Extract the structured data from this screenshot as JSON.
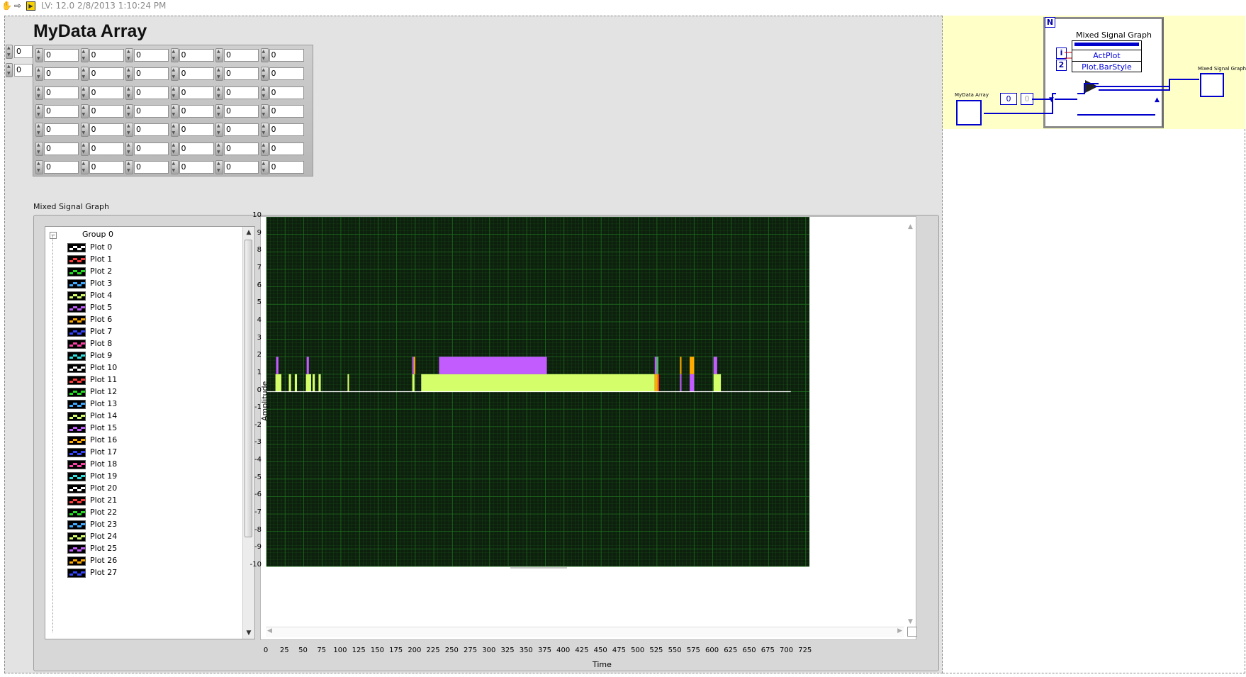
{
  "topbar": {
    "version_text": "LV: 12.0 2/8/2013 1:10:24 PM",
    "icons": [
      "hand-tool-icon",
      "run-arrow-icon",
      "vi-icon"
    ]
  },
  "front_panel": {
    "array_title": "MyData Array",
    "index_values": [
      "0",
      "0"
    ],
    "array_values": [
      [
        "0",
        "0",
        "0",
        "0",
        "0",
        "0"
      ],
      [
        "0",
        "0",
        "0",
        "0",
        "0",
        "0"
      ],
      [
        "0",
        "0",
        "0",
        "0",
        "0",
        "0"
      ],
      [
        "0",
        "0",
        "0",
        "0",
        "0",
        "0"
      ],
      [
        "0",
        "0",
        "0",
        "0",
        "0",
        "0"
      ],
      [
        "0",
        "0",
        "0",
        "0",
        "0",
        "0"
      ],
      [
        "0",
        "0",
        "0",
        "0",
        "0",
        "0"
      ]
    ],
    "graph_label": "Mixed Signal Graph"
  },
  "legend": {
    "group": "Group 0",
    "plots": [
      {
        "label": "Plot 0",
        "color": "#ffffff"
      },
      {
        "label": "Plot 1",
        "color": "#ff3b3b"
      },
      {
        "label": "Plot 2",
        "color": "#22dd22"
      },
      {
        "label": "Plot 3",
        "color": "#3fa9ff"
      },
      {
        "label": "Plot 4",
        "color": "#d4ff6a"
      },
      {
        "label": "Plot 5",
        "color": "#c25cff"
      },
      {
        "label": "Plot 6",
        "color": "#ffaa00"
      },
      {
        "label": "Plot 7",
        "color": "#3344ff"
      },
      {
        "label": "Plot 8",
        "color": "#ff3fa8"
      },
      {
        "label": "Plot 9",
        "color": "#33e0e0"
      },
      {
        "label": "Plot 10",
        "color": "#ffffff"
      },
      {
        "label": "Plot 11",
        "color": "#ff3b3b"
      },
      {
        "label": "Plot 12",
        "color": "#22dd22"
      },
      {
        "label": "Plot 13",
        "color": "#3fa9ff"
      },
      {
        "label": "Plot 14",
        "color": "#d4ff6a"
      },
      {
        "label": "Plot 15",
        "color": "#c25cff"
      },
      {
        "label": "Plot 16",
        "color": "#ffaa00"
      },
      {
        "label": "Plot 17",
        "color": "#3344ff"
      },
      {
        "label": "Plot 18",
        "color": "#ff3fa8"
      },
      {
        "label": "Plot 19",
        "color": "#33e0e0"
      },
      {
        "label": "Plot 20",
        "color": "#ffffff"
      },
      {
        "label": "Plot 21",
        "color": "#ff3b3b"
      },
      {
        "label": "Plot 22",
        "color": "#22dd22"
      },
      {
        "label": "Plot 23",
        "color": "#3fa9ff"
      },
      {
        "label": "Plot 24",
        "color": "#d4ff6a"
      },
      {
        "label": "Plot 25",
        "color": "#c25cff"
      },
      {
        "label": "Plot 26",
        "color": "#ffaa00"
      },
      {
        "label": "Plot 27",
        "color": "#3344ff"
      }
    ]
  },
  "chart_data": {
    "type": "bar",
    "xlabel": "Time",
    "ylabel": "Amplitude",
    "xlim": [
      0,
      730
    ],
    "ylim": [
      -10,
      10
    ],
    "x_ticks": [
      0,
      25,
      50,
      75,
      100,
      125,
      150,
      175,
      200,
      225,
      250,
      275,
      300,
      325,
      350,
      375,
      400,
      425,
      450,
      475,
      500,
      525,
      550,
      575,
      600,
      625,
      650,
      675,
      700,
      725
    ],
    "y_ticks": [
      10,
      9,
      8,
      7,
      6,
      5,
      4,
      3,
      2,
      1,
      0,
      -1,
      -2,
      -3,
      -4,
      -5,
      -6,
      -7,
      -8,
      -9,
      -10
    ],
    "baseline": {
      "x": [
        0,
        705
      ],
      "y": 0,
      "color": "#ffffff"
    },
    "background": "#0d1f0d",
    "grid_color": "#1f6e1f",
    "bars": [
      {
        "x0": 12,
        "x1": 20,
        "y0": 0,
        "y1": 1,
        "color": "#d4ff6a"
      },
      {
        "x0": 13,
        "x1": 16,
        "y0": 1,
        "y1": 2,
        "color": "#c25cff"
      },
      {
        "x0": 30,
        "x1": 33,
        "y0": 0,
        "y1": 1,
        "color": "#d4ff6a"
      },
      {
        "x0": 38,
        "x1": 41,
        "y0": 0,
        "y1": 1,
        "color": "#d4ff6a"
      },
      {
        "x0": 53,
        "x1": 60,
        "y0": 0,
        "y1": 1,
        "color": "#d4ff6a"
      },
      {
        "x0": 54,
        "x1": 57,
        "y0": 1,
        "y1": 2,
        "color": "#c25cff"
      },
      {
        "x0": 62,
        "x1": 65,
        "y0": 0,
        "y1": 1,
        "color": "#d4ff6a"
      },
      {
        "x0": 70,
        "x1": 73,
        "y0": 0,
        "y1": 1,
        "color": "#d4ff6a"
      },
      {
        "x0": 109,
        "x1": 111,
        "y0": 0,
        "y1": 1,
        "color": "#d4ff6a"
      },
      {
        "x0": 196,
        "x1": 199,
        "y0": 0,
        "y1": 1,
        "color": "#d4ff6a"
      },
      {
        "x0": 196,
        "x1": 198,
        "y0": 1,
        "y1": 2,
        "color": "#c25cff"
      },
      {
        "x0": 198,
        "x1": 200,
        "y0": 1,
        "y1": 2,
        "color": "#ffaa00"
      },
      {
        "x0": 208,
        "x1": 522,
        "y0": 0,
        "y1": 1,
        "color": "#d4ff6a"
      },
      {
        "x0": 232,
        "x1": 377,
        "y0": 1,
        "y1": 2,
        "color": "#c25cff"
      },
      {
        "x0": 522,
        "x1": 526,
        "y0": 1,
        "y1": 2,
        "color": "#c25cff"
      },
      {
        "x0": 525,
        "x1": 527,
        "y0": 1,
        "y1": 2,
        "color": "#22dd22"
      },
      {
        "x0": 522,
        "x1": 526,
        "y0": 0,
        "y1": 1,
        "color": "#ffaa00"
      },
      {
        "x0": 526,
        "x1": 528,
        "y0": 0,
        "y1": 1,
        "color": "#ff3b3b"
      },
      {
        "x0": 556,
        "x1": 558,
        "y0": 1,
        "y1": 2,
        "color": "#ffaa00"
      },
      {
        "x0": 556,
        "x1": 558,
        "y0": 0,
        "y1": 1,
        "color": "#c25cff"
      },
      {
        "x0": 569,
        "x1": 575,
        "y0": 1,
        "y1": 2,
        "color": "#ffaa00"
      },
      {
        "x0": 569,
        "x1": 575,
        "y0": 0,
        "y1": 1,
        "color": "#c25cff"
      },
      {
        "x0": 601,
        "x1": 606,
        "y0": 1,
        "y1": 2,
        "color": "#c25cff"
      },
      {
        "x0": 601,
        "x1": 611,
        "y0": 0,
        "y1": 1,
        "color": "#d4ff6a"
      }
    ]
  },
  "block_diagram": {
    "loop_letter": "N",
    "property_node_title": "Mixed Signal Graph",
    "property_rows": [
      "ActPlot",
      "Plot.BarStyle"
    ],
    "iteration_label": "i",
    "const_2": "2",
    "const_0": "0",
    "mydata_terminal_label": "MyData Array",
    "graph_terminal_label": "Mixed Signal Graph"
  }
}
